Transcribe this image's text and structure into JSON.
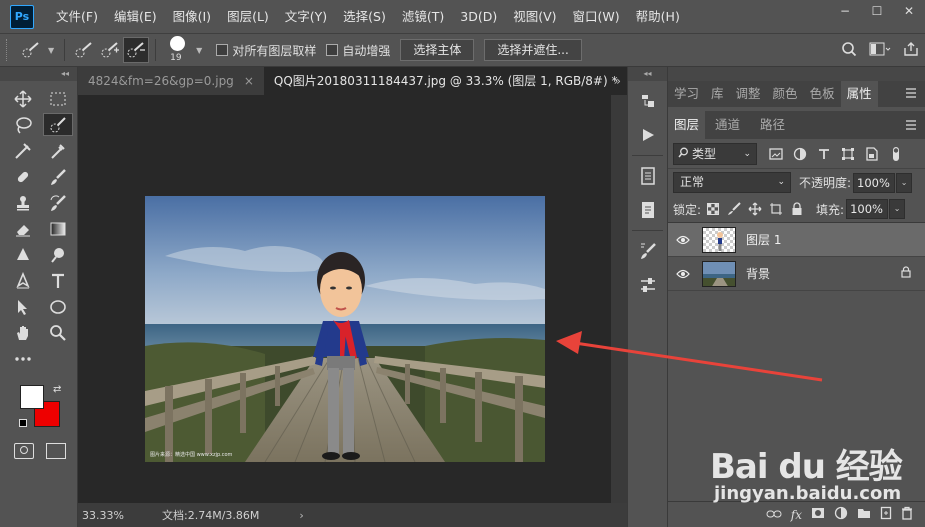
{
  "app": {
    "logo_text": "Ps"
  },
  "menu": [
    "文件(F)",
    "编辑(E)",
    "图像(I)",
    "图层(L)",
    "文字(Y)",
    "选择(S)",
    "滤镜(T)",
    "3D(D)",
    "视图(V)",
    "窗口(W)",
    "帮助(H)"
  ],
  "window_buttons": {
    "minimize": "−",
    "maximize": "☐",
    "close": "✕"
  },
  "options": {
    "brush_size": "19",
    "sample_all_layers": "对所有图层取样",
    "auto_enhance": "自动增强",
    "select_subject": "选择主体",
    "select_and_mask": "选择并遮住..."
  },
  "tabs": [
    {
      "label": "4824&fm=26&gp=0.jpg",
      "close": "×"
    },
    {
      "label": "QQ图片20180311184437.jpg @ 33.3% (图层 1, RGB/8#) *",
      "close": "×"
    }
  ],
  "tab_overflow": "»",
  "status": {
    "zoom": "33.33%",
    "doc": "文档:2.74M/3.86M",
    "arrow": "›"
  },
  "photo_caption": "图片来源：精选中国 www.xzjp.com",
  "colors": {
    "foreground": "#ffffff",
    "background": "#ee0000"
  },
  "panel_tabs_top": [
    "学习",
    "库",
    "调整",
    "颜色",
    "色板",
    "属性"
  ],
  "panel_tabs_layers": [
    "图层",
    "通道",
    "路径"
  ],
  "layers_panel": {
    "filter_label": "类型",
    "blend_mode": "正常",
    "opacity_label": "不透明度:",
    "opacity_value": "100%",
    "lock_label": "锁定:",
    "fill_label": "填充:",
    "fill_value": "100%",
    "layers": [
      {
        "name": "图层 1",
        "selected": true
      },
      {
        "name": "背景",
        "selected": false
      }
    ]
  },
  "watermark": {
    "logo": "Bai du 经验",
    "url": "jingyan.baidu.com"
  }
}
